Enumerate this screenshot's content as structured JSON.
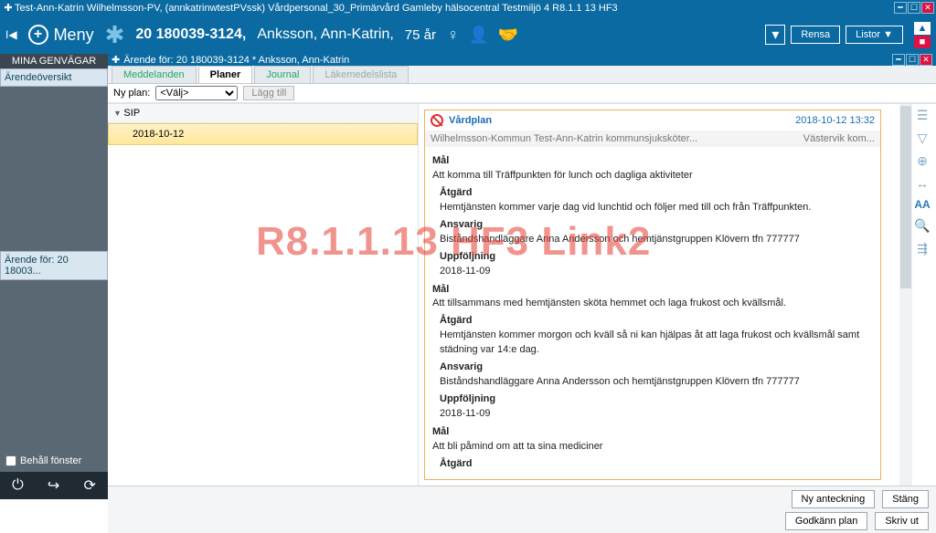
{
  "titlebar": {
    "text": "Test-Ann-Katrin  Wilhelmsson-PV, (annkatrinwtestPVssk) Vårdpersonal_30_Primärvård Gamleby hälsocentral Testmiljö 4 R8.1.1 13 HF3"
  },
  "topbar": {
    "menu": "Meny",
    "patient_id": "20 180039-3124,",
    "patient_name": "Anksson, Ann-Katrin,",
    "patient_age": "75 år",
    "rensa": "Rensa",
    "listor": "Listor ▼"
  },
  "sidebar": {
    "header": "MINA GENVÄGAR",
    "item0": "Ärendeöversikt",
    "open_case": "Ärende för: 20 18003...",
    "keep_window": "Behåll fönster"
  },
  "case": {
    "title": "Ärende för: 20 180039-3124 * Anksson, Ann-Katrin"
  },
  "tabs": {
    "t0": "Meddelanden",
    "t1": "Planer",
    "t2": "Journal",
    "t3": "Läkemedelslista"
  },
  "planrow": {
    "label": "Ny plan:",
    "select": "<Välj>",
    "add": "Lägg till"
  },
  "tree": {
    "group": "SIP",
    "leaf": "2018-10-12"
  },
  "detail": {
    "title": "Vårdplan",
    "datetime": "2018-10-12 13:32",
    "author": "Wilhelmsson-Kommun Test-Ann-Katrin kommunsjuksköter...",
    "unit": "Västervik kom...",
    "mal": "Mål",
    "atgard": "Åtgärd",
    "ansvarig": "Ansvarig",
    "uppf": "Uppföljning",
    "g1_mal": "Att komma till Träffpunkten för lunch och dagliga aktiviteter",
    "g1_atg": "Hemtjänsten kommer varje dag vid lunchtid och följer med till och från Träffpunkten.",
    "g1_ans": "Biståndshandläggare Anna Andersson och hemtjänstgruppen Klövern tfn 777777",
    "g1_upf": "2018-11-09",
    "g2_mal": "Att tillsammans med hemtjänsten sköta hemmet och laga frukost och kvällsmål.",
    "g2_atg": "Hemtjänsten kommer morgon och kväll så ni kan hjälpas åt att laga frukost och kvällsmål samt städning var 14:e dag.",
    "g2_ans": "Biståndshandläggare Anna Andersson och hemtjänstgruppen Klövern tfn 777777",
    "g2_upf": "2018-11-09",
    "g3_mal": "Att bli påmind om att ta sina mediciner"
  },
  "footer": {
    "ny": "Ny anteckning",
    "stang": "Stäng",
    "godkann": "Godkänn plan",
    "skriv": "Skriv ut"
  },
  "watermark": "R8.1.1.13 HF3 Link2"
}
